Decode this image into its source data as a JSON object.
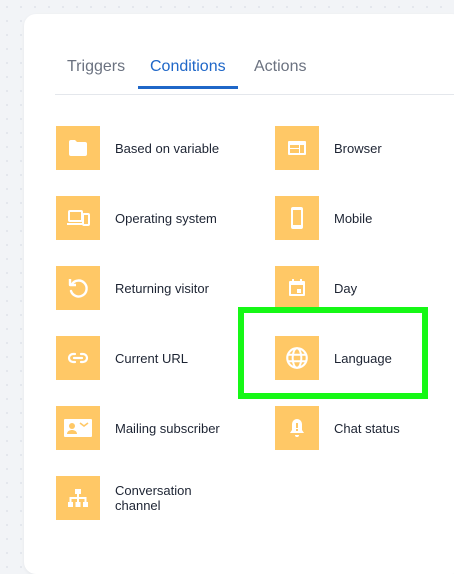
{
  "tabs": [
    {
      "label": "Triggers"
    },
    {
      "label": "Conditions"
    },
    {
      "label": "Actions"
    }
  ],
  "active_tab": "Conditions",
  "conditions": {
    "left": [
      {
        "label": "Based on variable",
        "icon": "folder-icon"
      },
      {
        "label": "Operating system",
        "icon": "devices-icon"
      },
      {
        "label": "Returning visitor",
        "icon": "restore-icon"
      },
      {
        "label": "Current URL",
        "icon": "link-icon"
      },
      {
        "label": "Mailing subscriber",
        "icon": "contact-mail-icon"
      },
      {
        "label": "Conversation\nchannel",
        "icon": "sitemap-icon"
      }
    ],
    "right": [
      {
        "label": "Browser",
        "icon": "browser-icon"
      },
      {
        "label": "Mobile",
        "icon": "smartphone-icon"
      },
      {
        "label": "Day",
        "icon": "calendar-icon"
      },
      {
        "label": "Language",
        "icon": "globe-icon"
      },
      {
        "label": "Chat status",
        "icon": "bell-icon"
      }
    ]
  },
  "colors": {
    "accent": "#1f67c8",
    "tile": "#ffc866",
    "highlight": "#16f816"
  }
}
